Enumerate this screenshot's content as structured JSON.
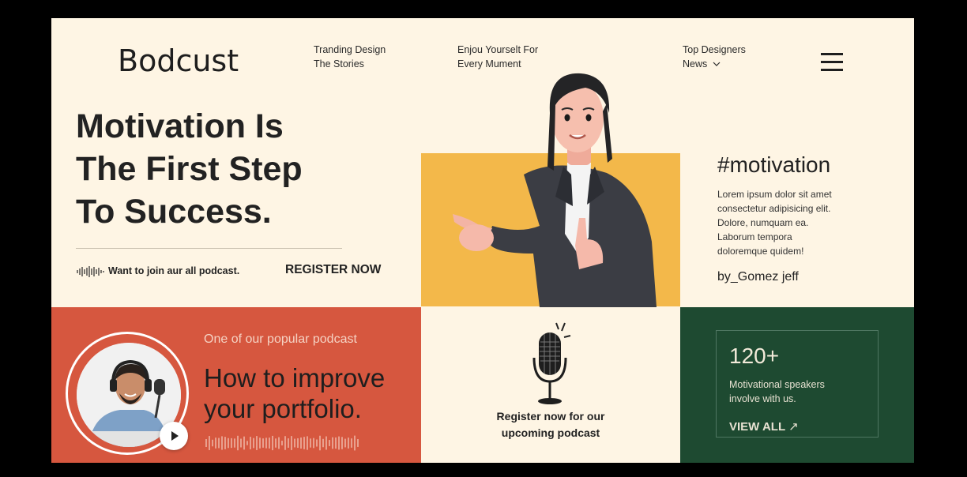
{
  "header": {
    "logo": "Bodcust",
    "nav": [
      {
        "line1": "Tranding Design",
        "line2": "The Stories"
      },
      {
        "line1": "Enjou Yourselt For",
        "line2": "Every Mument"
      },
      {
        "line1": "Top Designers",
        "line2": "News"
      }
    ],
    "menu_icon": "hamburger-icon"
  },
  "hero": {
    "headline": [
      "Motivation Is",
      "The First Step",
      "To Success."
    ],
    "join_text": "Want to join aur all podcast.",
    "register_label": "REGISTER NOW"
  },
  "quote": {
    "hashtag": "#motivation",
    "lorem": [
      "Lorem ipsum dolor sit amet",
      "consectetur adipisicing elit.",
      "Dolore, numquam ea.",
      "Laborum tempora",
      "doloremque quidem!"
    ],
    "byline": "by_Gomez jeff"
  },
  "podcast": {
    "eyebrow": "One of our popular podcast",
    "title": [
      "How to improve",
      "your portfolio."
    ]
  },
  "upcoming": {
    "text": [
      "Register now for our",
      "upcoming podcast"
    ]
  },
  "stats": {
    "number": "120+",
    "desc": [
      "Motivational speakers",
      "involve with us."
    ],
    "view_all": "VIEW ALL",
    "arrow": "↗"
  },
  "colors": {
    "cream": "#fef5e4",
    "yellow": "#f3b84a",
    "red": "#d6573f",
    "green": "#1e4a31"
  }
}
